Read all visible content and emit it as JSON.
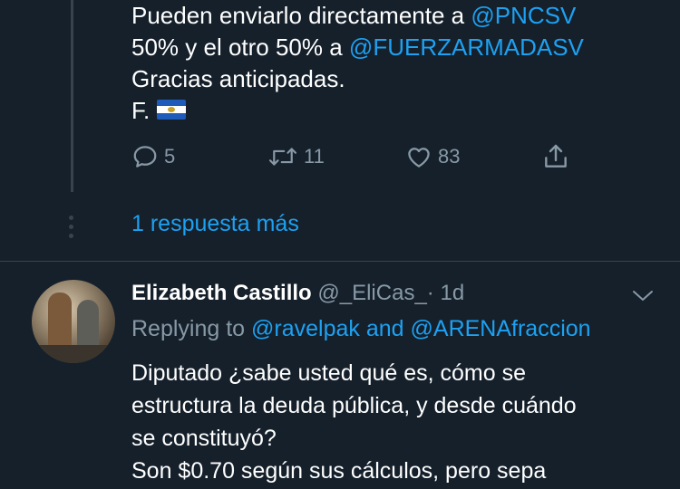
{
  "tweet1": {
    "line1_text": "Pueden enviarlo directamente a ",
    "line1_mention": "@PNCSV",
    "line2_text": "50% y el otro 50% a ",
    "line2_mention": "@FUERZARMADASV",
    "line3": "Gracias anticipadas.",
    "line4": "F.",
    "flag_icon": "el-salvador-flag"
  },
  "actions": {
    "reply_count": "5",
    "retweet_count": "11",
    "like_count": "83"
  },
  "more_replies": "1 respuesta más",
  "tweet2": {
    "author_name": "Elizabeth Castillo",
    "handle": "@_EliCas_",
    "separator": "·",
    "time": "1d",
    "replying_prefix": "Replying to ",
    "replying_user1": "@ravelpak",
    "replying_and": " and ",
    "replying_user2": "@ARENAfraccion",
    "lines": [
      "Diputado ¿sabe usted qué es, cómo se",
      "estructura la deuda pública, y desde cuándo",
      "se constituyó?",
      "Son $0.70 según sus cálculos, pero sepa"
    ]
  },
  "colors": {
    "background": "#15202b",
    "accent": "#1da1f2",
    "muted": "#8899a6",
    "divider": "#38444d"
  }
}
